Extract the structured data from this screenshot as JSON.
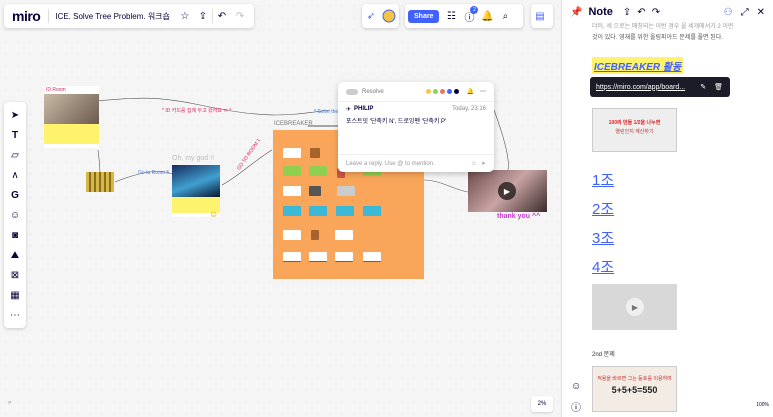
{
  "app": {
    "logo": "miro",
    "board_title": "ICE. Solve Tree Problem. 워크숍"
  },
  "topbar": {
    "share_label": "Share",
    "notification_count": "2"
  },
  "canvas": {
    "label_sticky_top": "* ID 카드를 집에 두고 왔어요 ㅠ *",
    "label_solve": "* Solve the",
    "icebreaker_caption": "ICEBREAKER",
    "oh_my_god": "Oh, my god !!",
    "thank_you": "thank you ^^",
    "go_to_room": "Go to Room 5",
    "arrow_text": "GO TO ROOM 1",
    "small_title_left": "ID Room",
    "zoom_bottom": "2%"
  },
  "comment": {
    "resolve_label": "Resolve",
    "author": "PHILIP",
    "time": "Today, 23:16",
    "text": "포스트잇 '단축키 N', 드로잉펜 '단축키 P'",
    "reply_placeholder": "Leave a reply. Use @ to mention.",
    "dot_colors": [
      "#f2c94c",
      "#8fd14f",
      "#e6776b",
      "#4262ff",
      "#050038"
    ]
  },
  "note": {
    "title": "Note",
    "intro": "것이 있다. 영재를 위한 올림피아드 문제를 풀면 된다.",
    "intro_top": "더러, 세 으로는 매칭되는 이번 경우 을 세개에서가 2 이런",
    "heading": "ICEBREAKER 활동",
    "link_url": "https://miro.com/app/board...",
    "groups": [
      "1조",
      "2조",
      "3조",
      "4조"
    ],
    "img1_caption": "100의 만들 1/2을 나누면",
    "img1_sub": "열린인지 계산하기",
    "section2": "2nd 문제",
    "img2_line1": "적용을 바르면 그는 등호를 이용하여",
    "img2_line2": "5+5+5=550",
    "zoom": "100%"
  }
}
